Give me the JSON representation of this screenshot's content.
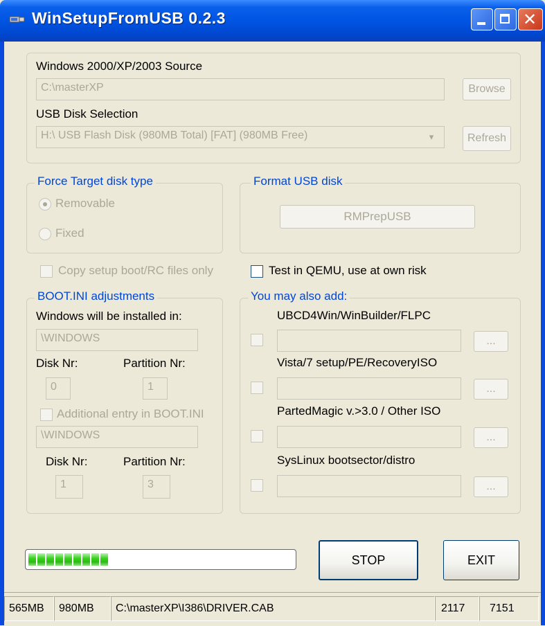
{
  "window": {
    "title": "WinSetupFromUSB 0.2.3",
    "icon": "usb-app-icon"
  },
  "source": {
    "label": "Windows 2000/XP/2003 Source",
    "value": "C:\\masterXP",
    "browse_label": "Browse"
  },
  "usb": {
    "label": "USB Disk Selection",
    "value": "H:\\ USB Flash Disk (980MB Total) [FAT] (980MB Free)",
    "refresh_label": "Refresh"
  },
  "force_target": {
    "legend": "Force Target disk type",
    "removable_label": "Removable",
    "fixed_label": "Fixed",
    "selected": "Removable"
  },
  "format_usb": {
    "legend": "Format USB disk",
    "button_label": "RMPrepUSB"
  },
  "copy_setup": {
    "label": "Copy setup boot/RC files only",
    "checked": false
  },
  "qemu": {
    "label": "Test in QEMU, use at own risk",
    "checked": false
  },
  "bootini": {
    "legend": "BOOT.INI adjustments",
    "installed_in_label": "Windows will be installed in:",
    "installed_in_value": "\\WINDOWS",
    "disk_nr_label": "Disk Nr:",
    "partition_nr_label": "Partition Nr:",
    "disk_nr_value": "0",
    "partition_nr_value": "1",
    "additional_label": "Additional entry in BOOT.INI",
    "additional_value": "\\WINDOWS",
    "disk_nr_label_2": "Disk Nr:",
    "partition_nr_label_2": "Partition Nr:",
    "disk_nr_value_2": "1",
    "partition_nr_value_2": "3"
  },
  "also_add": {
    "legend": "You may also add:",
    "items": [
      {
        "label": "UBCD4Win/WinBuilder/FLPC",
        "value": "",
        "browse": "..."
      },
      {
        "label": "Vista/7 setup/PE/RecoveryISO",
        "value": "",
        "browse": "..."
      },
      {
        "label": "PartedMagic v.>3.0 / Other ISO",
        "value": "",
        "browse": "..."
      },
      {
        "label": "SysLinux bootsector/distro",
        "value": "",
        "browse": "..."
      }
    ]
  },
  "progress": {
    "fraction": 0.3,
    "segments": 9
  },
  "buttons": {
    "stop_label": "STOP",
    "exit_label": "EXIT"
  },
  "statusbar": {
    "cells": [
      "565MB",
      "980MB",
      "C:\\masterXP\\I386\\DRIVER.CAB",
      "2117",
      "7151"
    ]
  },
  "colors": {
    "group_legend": "#0046D5",
    "disabled_text": "#ACA899",
    "progress": "#2CBB14"
  }
}
